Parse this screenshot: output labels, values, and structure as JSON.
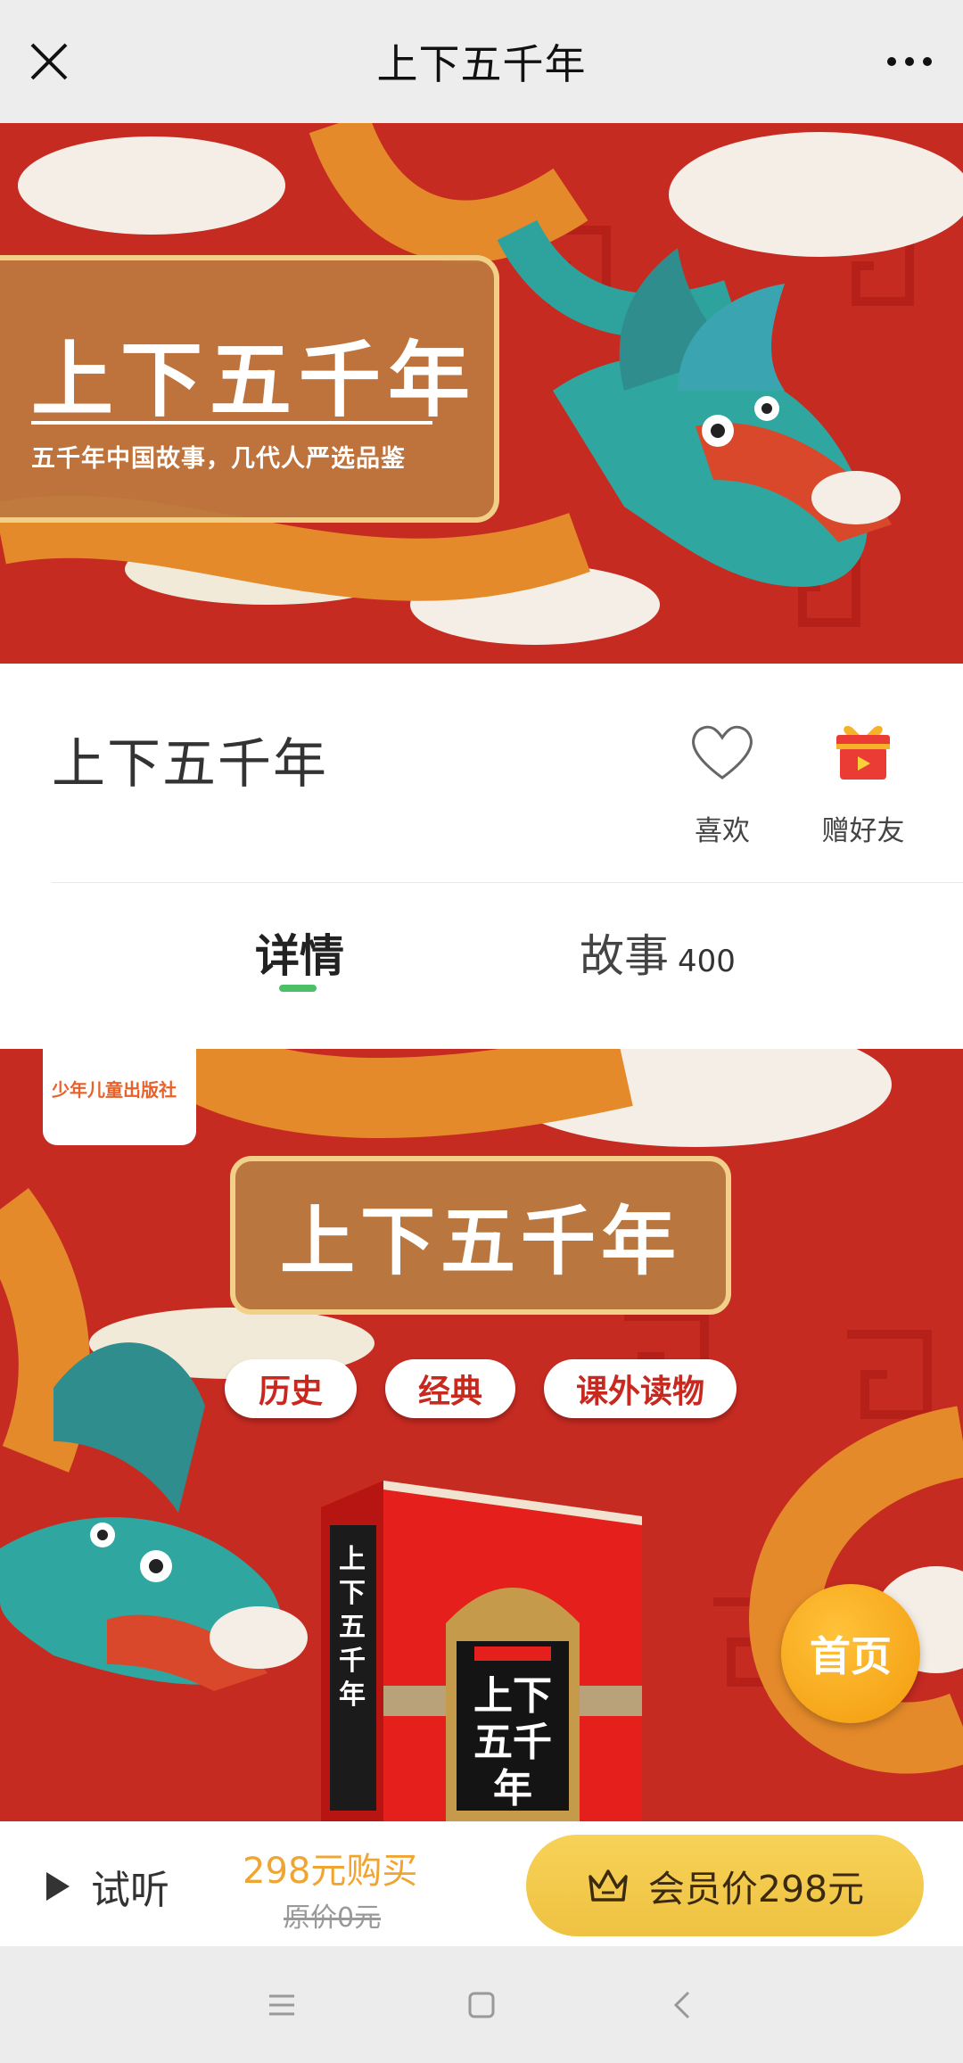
{
  "topbar": {
    "title": "上下五千年",
    "close_icon": "close-icon",
    "more_icon": "more-icon"
  },
  "banner": {
    "title": "上下五千年",
    "subtitle": "五千年中国故事，几代人严选品鉴"
  },
  "info": {
    "name": "上下五千年",
    "like_label": "喜欢",
    "gift_label": "赠好友"
  },
  "tabs": [
    {
      "label": "详情",
      "active": true
    },
    {
      "label": "故事",
      "count": "400"
    }
  ],
  "detail": {
    "publisher": "少年儿童出版社",
    "title": "上下五千年",
    "tags": [
      "历史",
      "经典",
      "课外读物"
    ],
    "book_spine": "上下五千年",
    "book_cover": "上下五千年"
  },
  "home_button": "首页",
  "buybar": {
    "trial": "试听",
    "price": "298元购买",
    "original": "原价0元",
    "member": "会员价298元"
  },
  "colors": {
    "accent_green": "#4cc069",
    "price_orange": "#f0a533",
    "button_gold": "#efc242",
    "banner_red": "#c8281e"
  }
}
